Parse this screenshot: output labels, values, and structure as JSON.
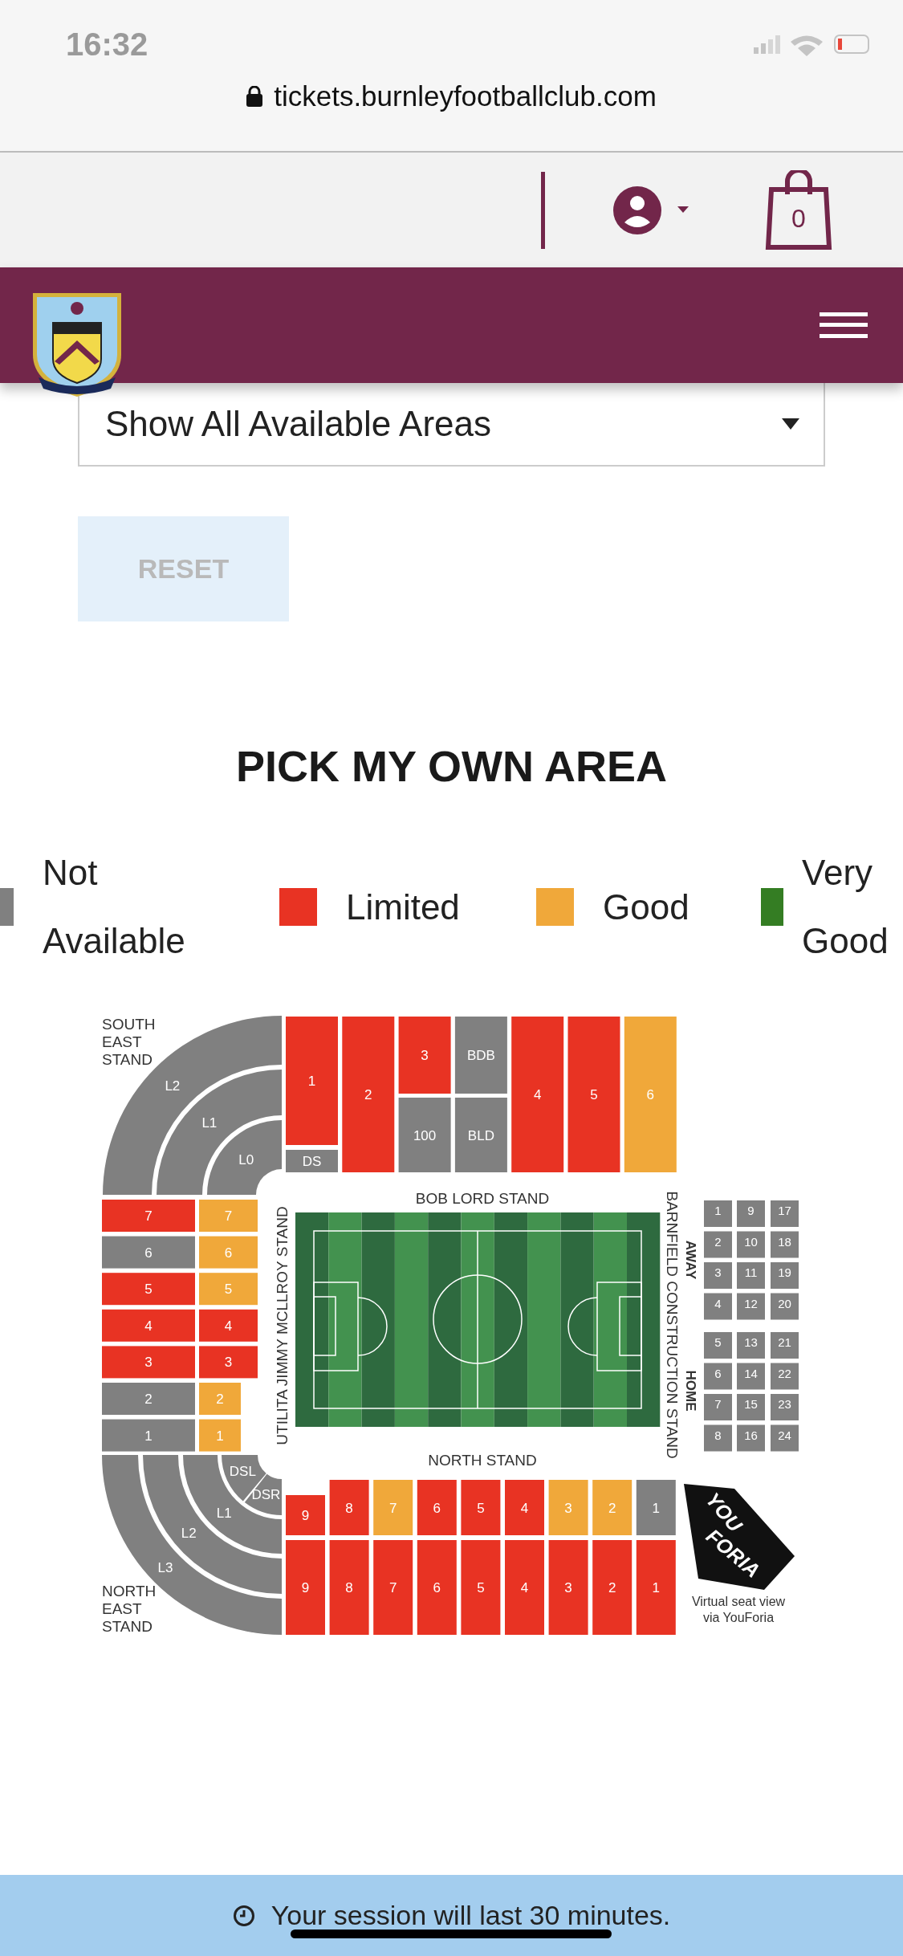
{
  "status_bar": {
    "time": "16:32"
  },
  "browser": {
    "url": "tickets.burnleyfootballclub.com"
  },
  "toolbar": {
    "cart_count": "0"
  },
  "area_filter": {
    "value": "Show All Available Areas"
  },
  "reset_button": {
    "label": "RESET",
    "disabled": true
  },
  "heading": "PICK MY OWN AREA",
  "legend": [
    {
      "label": "Not Available",
      "color": "#808080"
    },
    {
      "label": "Limited",
      "color": "#e83323"
    },
    {
      "label": "Good",
      "color": "#f0a83a"
    },
    {
      "label": "Very Good",
      "color": "#347d23"
    }
  ],
  "map": {
    "south_east_label": [
      "SOUTH",
      "EAST",
      "STAND"
    ],
    "south_east_sections": [
      {
        "label": "L2",
        "color": "#808080"
      },
      {
        "label": "L1",
        "color": "#808080"
      },
      {
        "label": "L0",
        "color": "#808080"
      }
    ],
    "top_stand": [
      {
        "label": "1",
        "color": "#e83323"
      },
      {
        "label": "2",
        "color": "#e83323"
      },
      {
        "label": "3",
        "color": "#e83323"
      },
      {
        "label": "BDB",
        "color": "#808080"
      },
      {
        "label": "4",
        "color": "#e83323"
      },
      {
        "label": "5",
        "color": "#e83323"
      },
      {
        "label": "6",
        "color": "#f0a83a"
      },
      {
        "label": "DS",
        "color": "#808080"
      },
      {
        "label": "100",
        "color": "#808080"
      },
      {
        "label": "BLD",
        "color": "#808080"
      }
    ],
    "top_label": "BOB LORD STAND",
    "left_label": "UTILITA JIMMY MCLLROY STAND",
    "right_label": "BARNFIELD CONSTRUCTION STAND",
    "bottom_label": "NORTH STAND",
    "away_label": "AWAY",
    "home_label": "HOME",
    "left_outer": [
      {
        "label": "7",
        "color": "#e83323"
      },
      {
        "label": "6",
        "color": "#808080"
      },
      {
        "label": "5",
        "color": "#e83323"
      },
      {
        "label": "4",
        "color": "#e83323"
      },
      {
        "label": "3",
        "color": "#e83323"
      },
      {
        "label": "2",
        "color": "#808080"
      },
      {
        "label": "1",
        "color": "#808080"
      }
    ],
    "left_inner": [
      {
        "label": "7",
        "color": "#f0a83a"
      },
      {
        "label": "6",
        "color": "#f0a83a"
      },
      {
        "label": "5",
        "color": "#f0a83a"
      },
      {
        "label": "4",
        "color": "#e83323"
      },
      {
        "label": "3",
        "color": "#e83323"
      },
      {
        "label": "2",
        "color": "#f0a83a"
      },
      {
        "label": "1",
        "color": "#f0a83a"
      }
    ],
    "right_stand": [
      {
        "label": "1",
        "color": "#808080"
      },
      {
        "label": "2",
        "color": "#808080"
      },
      {
        "label": "3",
        "color": "#808080"
      },
      {
        "label": "4",
        "color": "#808080"
      },
      {
        "label": "5",
        "color": "#808080"
      },
      {
        "label": "6",
        "color": "#808080"
      },
      {
        "label": "7",
        "color": "#808080"
      },
      {
        "label": "8",
        "color": "#808080"
      },
      {
        "label": "9",
        "color": "#808080"
      },
      {
        "label": "10",
        "color": "#808080"
      },
      {
        "label": "11",
        "color": "#808080"
      },
      {
        "label": "12",
        "color": "#808080"
      },
      {
        "label": "13",
        "color": "#808080"
      },
      {
        "label": "14",
        "color": "#808080"
      },
      {
        "label": "15",
        "color": "#808080"
      },
      {
        "label": "16",
        "color": "#808080"
      },
      {
        "label": "17",
        "color": "#808080"
      },
      {
        "label": "18",
        "color": "#808080"
      },
      {
        "label": "19",
        "color": "#808080"
      },
      {
        "label": "20",
        "color": "#808080"
      },
      {
        "label": "21",
        "color": "#808080"
      },
      {
        "label": "22",
        "color": "#808080"
      },
      {
        "label": "23",
        "color": "#808080"
      },
      {
        "label": "24",
        "color": "#808080"
      }
    ],
    "north_east_sections": [
      {
        "label": "L3",
        "color": "#808080"
      },
      {
        "label": "L2",
        "color": "#808080"
      },
      {
        "label": "L1",
        "color": "#808080"
      },
      {
        "label": "DSL",
        "color": "#808080"
      },
      {
        "label": "DSR",
        "color": "#808080"
      }
    ],
    "bottom_upper": [
      {
        "label": "9",
        "color": "#e83323"
      },
      {
        "label": "8",
        "color": "#e83323"
      },
      {
        "label": "7",
        "color": "#f0a83a"
      },
      {
        "label": "6",
        "color": "#e83323"
      },
      {
        "label": "5",
        "color": "#e83323"
      },
      {
        "label": "4",
        "color": "#e83323"
      },
      {
        "label": "3",
        "color": "#f0a83a"
      },
      {
        "label": "2",
        "color": "#f0a83a"
      },
      {
        "label": "1",
        "color": "#808080"
      }
    ],
    "bottom_lower": [
      {
        "label": "9",
        "color": "#e83323"
      },
      {
        "label": "8",
        "color": "#e83323"
      },
      {
        "label": "7",
        "color": "#e83323"
      },
      {
        "label": "6",
        "color": "#e83323"
      },
      {
        "label": "5",
        "color": "#e83323"
      },
      {
        "label": "4",
        "color": "#e83323"
      },
      {
        "label": "3",
        "color": "#e83323"
      },
      {
        "label": "2",
        "color": "#e83323"
      },
      {
        "label": "1",
        "color": "#e83323"
      }
    ],
    "north_east_label": [
      "NORTH",
      "EAST",
      "STAND"
    ],
    "logo_words": [
      "YOU",
      "FORIA"
    ],
    "logo_caption": [
      "Virtual seat view",
      "via YouForia"
    ]
  },
  "session_banner": {
    "text": "Your session will last 30 minutes."
  }
}
